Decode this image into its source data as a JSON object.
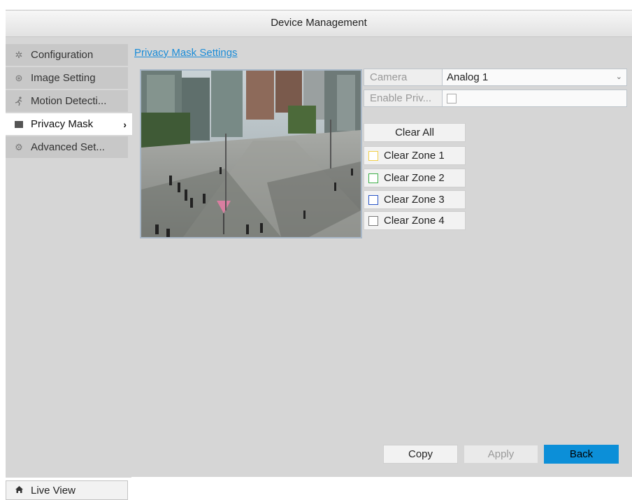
{
  "window": {
    "title": "Device Management"
  },
  "sidebar": {
    "items": [
      {
        "label": "Configuration",
        "icon": "gear-icon"
      },
      {
        "label": "Image Setting",
        "icon": "palette-icon"
      },
      {
        "label": "Motion Detecti...",
        "icon": "running-person-icon"
      },
      {
        "label": "Privacy Mask",
        "icon": "mask-square-icon",
        "active": true
      },
      {
        "label": "Advanced Set...",
        "icon": "advanced-gear-icon"
      }
    ],
    "live_view": {
      "label": "Live View",
      "icon": "home-icon"
    }
  },
  "section_link": "Privacy Mask Settings",
  "form": {
    "camera_label": "Camera",
    "camera_value": "Analog 1",
    "enable_label": "Enable Priv...",
    "enable_checked": false
  },
  "buttons": {
    "clear_all": "Clear All",
    "zones": [
      {
        "label": "Clear Zone 1",
        "color": "#f2d04a"
      },
      {
        "label": "Clear Zone 2",
        "color": "#3fb04a"
      },
      {
        "label": "Clear Zone 3",
        "color": "#2a55c8"
      },
      {
        "label": "Clear Zone 4",
        "color": "#7a7a7a"
      }
    ]
  },
  "footer": {
    "copy": "Copy",
    "apply": "Apply",
    "back": "Back"
  },
  "colors": {
    "accent": "#0c8fd8",
    "link": "#1a8cd8"
  }
}
